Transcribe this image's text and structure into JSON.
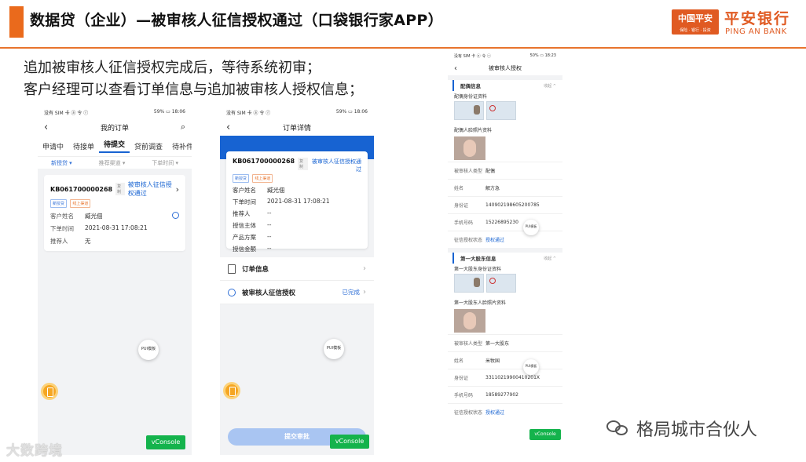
{
  "header": {
    "title": "数据贷（企业）—被审核人征信授权通过（口袋银行家APP）",
    "logo_box_text": "中国平安",
    "logo_box_sub": "保险 · 银行 · 投资",
    "logo_name": "平安银行",
    "logo_en": "PING AN BANK"
  },
  "description": {
    "line1": "追加被审核人征信授权完成后，等待系统初审；",
    "line2": "客户经理可以查看订单信息与追加被审核人授权信息；"
  },
  "phone1": {
    "status_left": "没有 SIM 卡 ⓐ 令 ⓡ",
    "status_right": "59% ▭ 18:06",
    "back": "‹",
    "title": "我的订单",
    "search": "⌕",
    "tabs": [
      "申请中",
      "待接单",
      "待提交",
      "贷前调查",
      "待补件"
    ],
    "active_tab": "待提交",
    "filters": [
      "新授贷 ▾",
      "推荐渠道 ▾",
      "下单时间 ▾"
    ],
    "order": {
      "no": "KB061700000268",
      "copy": "复制",
      "status": "被审核人征信授权通过",
      "chevron": "›",
      "tag1": "新授贷",
      "tag2": "线上渠道",
      "rows": [
        {
          "k": "客户姓名",
          "v": "臧光佃"
        },
        {
          "k": "下单时间",
          "v": "2021-08-31 17:08:21"
        },
        {
          "k": "推荐人",
          "v": "无"
        }
      ]
    },
    "pui": "PUI模板",
    "vconsole": "vConsole"
  },
  "phone2": {
    "status_left": "没有 SIM 卡 ⓐ 令 ⓡ",
    "status_right": "59% ▭ 18:06",
    "back": "‹",
    "title": "订单详情",
    "order_no": "KB061700000268",
    "copy": "复制",
    "status": "被审核人征信授权通过",
    "tag1": "新授贷",
    "tag2": "线上渠道",
    "rows": [
      {
        "k": "客户姓名",
        "v": "臧光佃"
      },
      {
        "k": "下单时间",
        "v": "2021-08-31 17:08:21"
      },
      {
        "k": "推荐人",
        "v": "--"
      },
      {
        "k": "授信主体",
        "v": "--"
      },
      {
        "k": "产品方案",
        "v": "--"
      },
      {
        "k": "授信金额",
        "v": "--"
      }
    ],
    "menu1": "订单信息",
    "menu2": "被审核人征信授权",
    "menu2_status": "已完成",
    "chevron": "›",
    "pui": "PUI模板",
    "submit": "提交审批",
    "vconsole": "vConsole"
  },
  "phone3": {
    "status_left": "没有 SIM 卡 ⓐ 令 ⓡ",
    "status_right": "50% ▭ 18:23",
    "back": "‹",
    "title": "被审核人授权",
    "section1": "配偶信息",
    "collapse": "收起 ^",
    "s1_id_label": "配偶身份证资料",
    "s1_face_label": "配偶人脸照片资料",
    "s1_rows": [
      {
        "k": "被审核人类型",
        "v": "配偶"
      },
      {
        "k": "姓名",
        "v": "解方急"
      },
      {
        "k": "身份证",
        "v": "140902198605200785"
      },
      {
        "k": "手机号码",
        "v": "15226895230"
      },
      {
        "k": "征信授权状态",
        "v": "授权通过"
      }
    ],
    "section2": "第一大股东信息",
    "s2_id_label": "第一大股东身份证资料",
    "s2_face_label": "第一大股东人脸照片资料",
    "s2_rows": [
      {
        "k": "被审核人类型",
        "v": "第一大股东"
      },
      {
        "k": "姓名",
        "v": "米牧国"
      },
      {
        "k": "身份证",
        "v": "33110219900410201X"
      },
      {
        "k": "手机号码",
        "v": "18589277902"
      },
      {
        "k": "征信授权状态",
        "v": "授权通过"
      }
    ],
    "pui": "PUI模板",
    "vconsole": "vConsole"
  },
  "watermark_left": "大数跨境",
  "watermark_right": "格局城市合伙人"
}
